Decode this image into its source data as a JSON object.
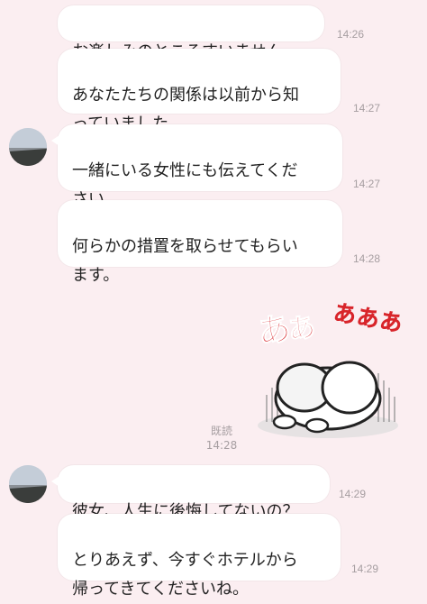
{
  "messages": [
    {
      "text": "お楽しみのところすいません。",
      "time": "14:26"
    },
    {
      "text": "あなたたちの関係は以前から知\nっていました。",
      "time": "14:27"
    },
    {
      "text": "一緒にいる女性にも伝えてくだ\nさい",
      "time": "14:27"
    },
    {
      "text": "何らかの措置を取らせてもらい\nます。",
      "time": "14:28"
    },
    {
      "text": "彼女、人生に後悔してないの？",
      "time": "14:29"
    },
    {
      "text": "とりあえず、今すぐホテルから\n帰ってきてくださいね。",
      "time": "14:29"
    }
  ],
  "sticker": {
    "name": "sticker-crying-character",
    "text_big": "あぁ",
    "text_small": "ぁぁぁ",
    "read_label": "既読",
    "time": "14:28"
  },
  "colors": {
    "background": "#fbeef1",
    "bubble": "#ffffff",
    "sticker_text": "#d8242a"
  }
}
